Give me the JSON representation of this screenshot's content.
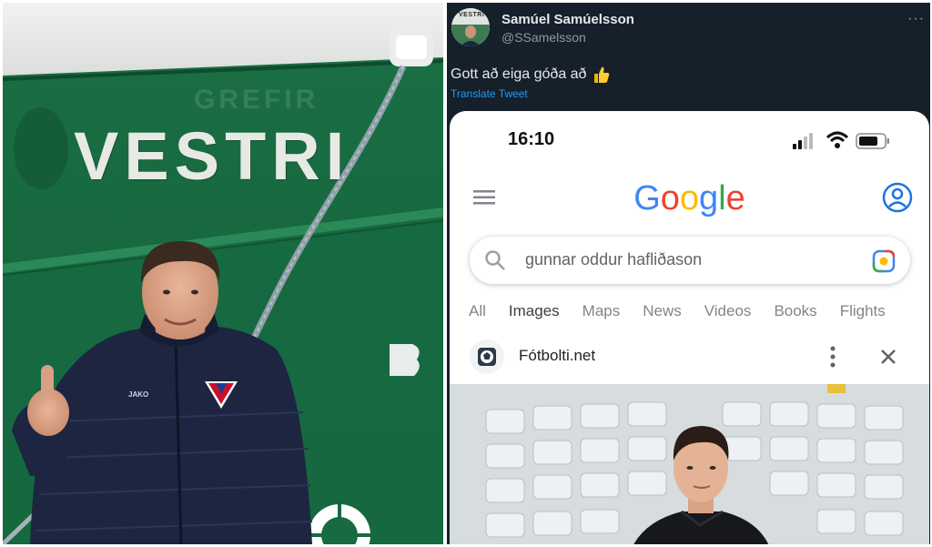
{
  "left_photo": {
    "hull_text": "VESTRI",
    "hull_ghost_text": "GREFIR",
    "jacket_brand": "JAKO"
  },
  "tweet": {
    "avatar_text": "VESTRI",
    "author_name": "Samúel Samúelsson",
    "author_handle": "@SSamelsson",
    "more_label": "···",
    "text": "Gott að eiga góða að",
    "emoji": "thumbs-up",
    "translate_label": "Translate Tweet"
  },
  "phone": {
    "status_time": "16:10",
    "google_logo_letters": [
      {
        "ch": "G",
        "color": "#4285f4"
      },
      {
        "ch": "o",
        "color": "#ea4335"
      },
      {
        "ch": "o",
        "color": "#fbbc05"
      },
      {
        "ch": "g",
        "color": "#4285f4"
      },
      {
        "ch": "l",
        "color": "#34a853"
      },
      {
        "ch": "e",
        "color": "#ea4335"
      }
    ],
    "search_query": "gunnar oddur hafliðason",
    "tabs": [
      "All",
      "Images",
      "Maps",
      "News",
      "Videos",
      "Books",
      "Flights"
    ],
    "active_tab": "Images",
    "source_name": "Fótbolti.net"
  },
  "colors": {
    "tweet_bg": "#15202b",
    "link_blue": "#1d9bf0",
    "hull_green": "#1f7a4a"
  }
}
